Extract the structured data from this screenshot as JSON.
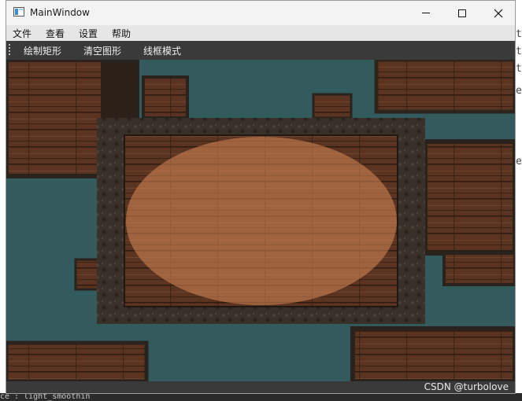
{
  "window": {
    "title": "MainWindow"
  },
  "menubar": {
    "items": [
      "文件",
      "查看",
      "设置",
      "帮助"
    ]
  },
  "toolbar": {
    "buttons": [
      "绘制矩形",
      "清空图形",
      "线框模式"
    ]
  },
  "statusbar": {
    "watermark": "CSDN @turbolove"
  },
  "background_editor": {
    "side_chars": [
      "t",
      "t",
      "t",
      "e",
      "e"
    ],
    "bottom_text": "ce : light_smoothin"
  },
  "scene": {
    "clear_color": "#335a5c",
    "ellipse_tint": "#d98a5a",
    "wood_color": "#5a3420",
    "frame_color": "#3a302a"
  }
}
